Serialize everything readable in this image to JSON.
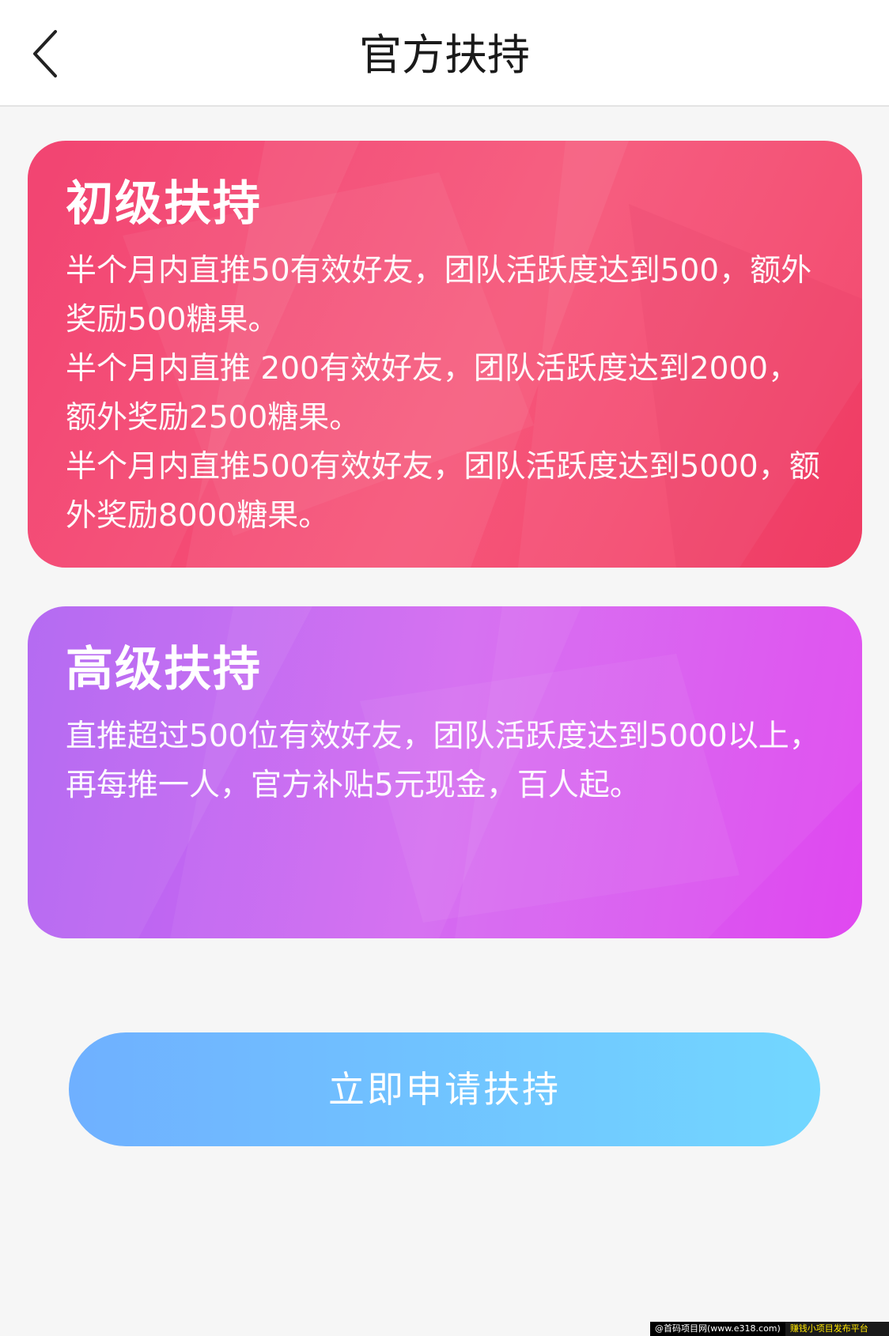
{
  "header": {
    "title": "官方扶持",
    "back_icon": "chevron-left-icon"
  },
  "cards": [
    {
      "title": "初级扶持",
      "lines": [
        "半个月内直推50有效好友，团队活跃度达到500，额外奖励500糖果。",
        "半个月内直推 200有效好友，团队活跃度达到2000，额外奖励2500糖果。",
        "半个月内直推500有效好友，团队活跃度达到5000，额外奖励8000糖果。"
      ],
      "colors": [
        "#f23a6a",
        "#f6567a"
      ]
    },
    {
      "title": "高级扶持",
      "lines": [
        "直推超过500位有效好友，团队活跃度达到5000以上，再每推一人，官方补贴5元现金，百人起。"
      ],
      "colors": [
        "#b062f2",
        "#e048f0"
      ]
    }
  ],
  "apply_button": {
    "label": "立即申请扶持",
    "colors": [
      "#6fb0ff",
      "#72d7ff"
    ]
  },
  "watermark": {
    "left": "@首码项目网(www.e318.com)",
    "right": "赚钱小项目发布平台"
  }
}
